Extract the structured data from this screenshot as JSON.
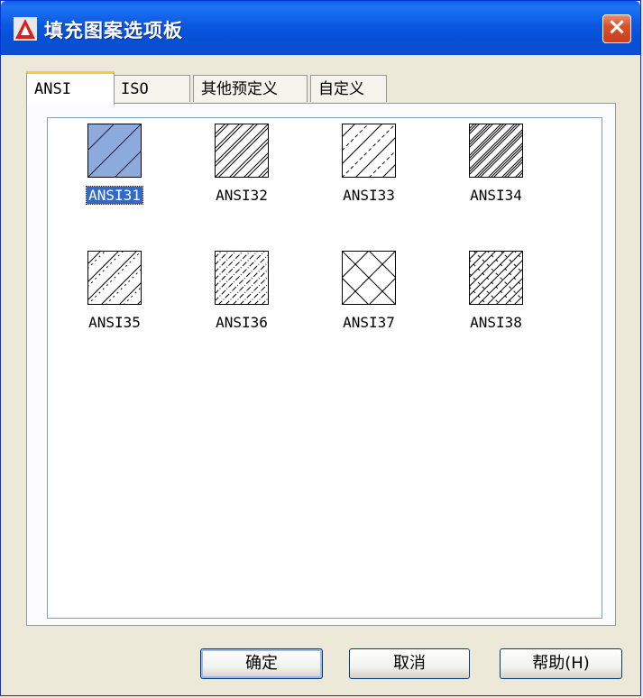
{
  "window": {
    "title": "填充图案选项板",
    "accent": "#0a5fe8"
  },
  "tabs": [
    {
      "label": "ANSI",
      "active": true
    },
    {
      "label": "ISO",
      "active": false
    },
    {
      "label": "其他预定义",
      "active": false
    },
    {
      "label": "自定义",
      "active": false
    }
  ],
  "patterns": [
    {
      "name": "ANSI31",
      "selected": true
    },
    {
      "name": "ANSI32",
      "selected": false
    },
    {
      "name": "ANSI33",
      "selected": false
    },
    {
      "name": "ANSI34",
      "selected": false
    },
    {
      "name": "ANSI35",
      "selected": false
    },
    {
      "name": "ANSI36",
      "selected": false
    },
    {
      "name": "ANSI37",
      "selected": false
    },
    {
      "name": "ANSI38",
      "selected": false
    }
  ],
  "buttons": {
    "ok": "确定",
    "cancel": "取消",
    "help": "帮助(H)"
  },
  "icons": {
    "app": "autocad-icon",
    "close": "close-icon"
  }
}
